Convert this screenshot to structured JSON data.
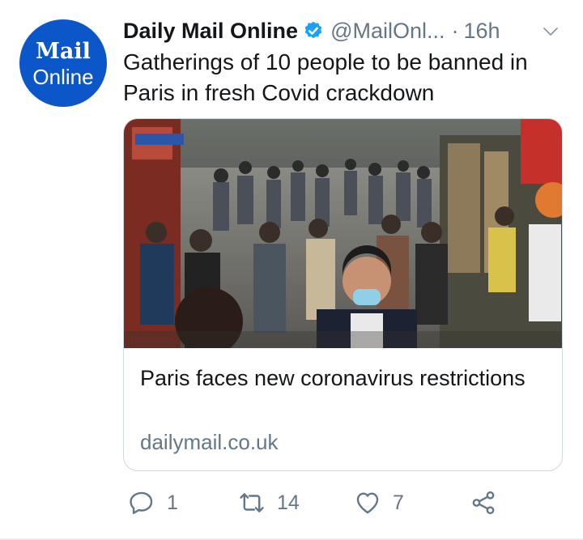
{
  "avatar": {
    "line1": "Mail",
    "line2": "Online",
    "color": "#0b57c9"
  },
  "tweet": {
    "author_name": "Daily Mail Online",
    "handle": "@MailOnl...",
    "separator": "·",
    "time": "16h",
    "text": "Gatherings of 10 people to be banned in Paris in fresh Covid crackdown"
  },
  "card": {
    "image_description": "crowded Paris street with pedestrians wearing masks",
    "title": "Paris faces new coronavirus restrictions",
    "domain": "dailymail.co.uk"
  },
  "actions": {
    "reply_count": "1",
    "retweet_count": "14",
    "like_count": "7"
  },
  "colors": {
    "verified": "#1da1f2",
    "secondary_text": "#657786",
    "border": "#cfd9de"
  }
}
